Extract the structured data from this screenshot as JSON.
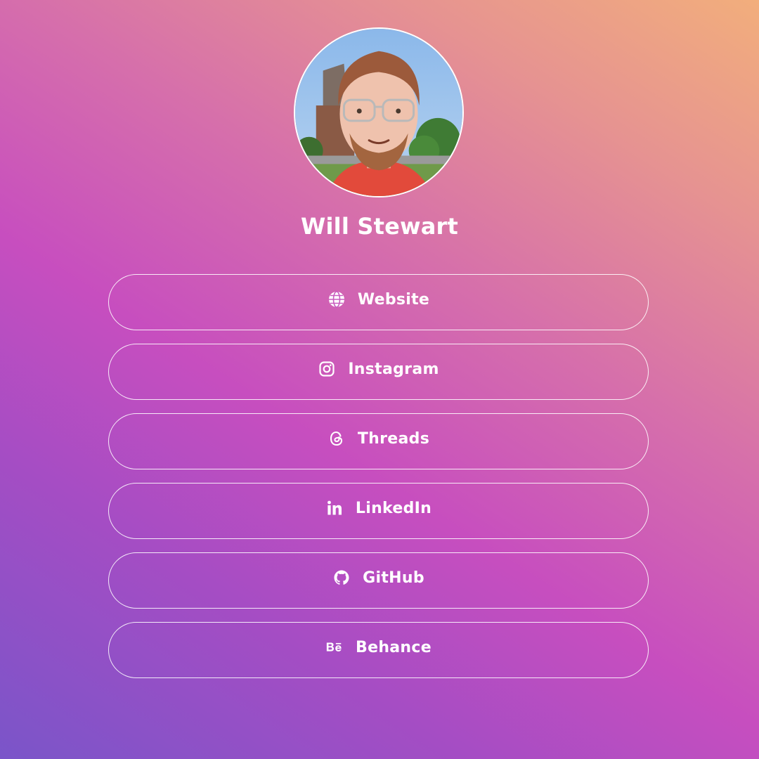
{
  "profile": {
    "name": "Will Stewart",
    "avatar_alt": "profile-photo"
  },
  "links": [
    {
      "label": "Website",
      "icon": "globe-icon"
    },
    {
      "label": "Instagram",
      "icon": "instagram-icon"
    },
    {
      "label": "Threads",
      "icon": "threads-icon"
    },
    {
      "label": "LinkedIn",
      "icon": "linkedin-icon"
    },
    {
      "label": "GitHub",
      "icon": "github-icon"
    },
    {
      "label": "Behance",
      "icon": "behance-icon"
    }
  ],
  "colors": {
    "gradient_start": "#7a55c9",
    "gradient_mid": "#c74ebf",
    "gradient_end": "#f2ae7c",
    "text": "#ffffff"
  }
}
